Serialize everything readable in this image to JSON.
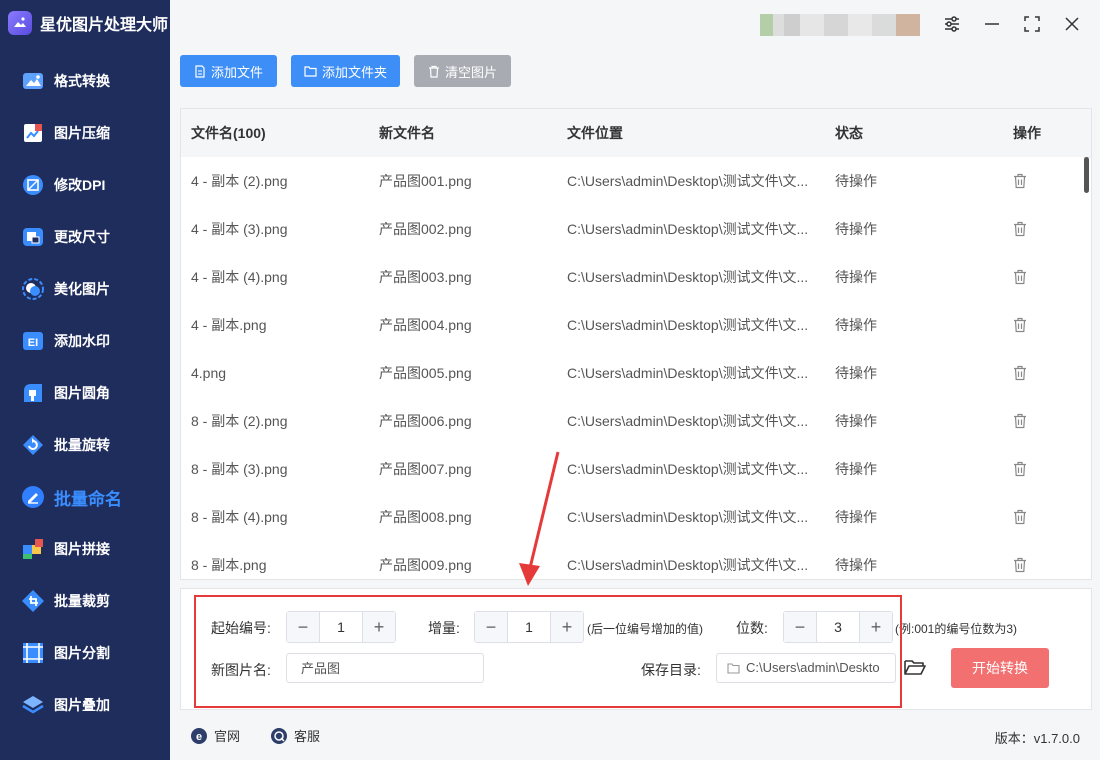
{
  "app": {
    "title": "星优图片处理大师"
  },
  "sidebar": {
    "items": [
      {
        "label": "格式转换",
        "icon": "format-convert-icon"
      },
      {
        "label": "图片压缩",
        "icon": "compress-icon"
      },
      {
        "label": "修改DPI",
        "icon": "dpi-icon"
      },
      {
        "label": "更改尺寸",
        "icon": "resize-icon"
      },
      {
        "label": "美化图片",
        "icon": "beautify-icon"
      },
      {
        "label": "添加水印",
        "icon": "watermark-icon"
      },
      {
        "label": "图片圆角",
        "icon": "rounded-corner-icon"
      },
      {
        "label": "批量旋转",
        "icon": "rotate-icon"
      },
      {
        "label": "批量命名",
        "icon": "rename-icon",
        "active": true
      },
      {
        "label": "图片拼接",
        "icon": "splice-icon"
      },
      {
        "label": "批量裁剪",
        "icon": "crop-icon"
      },
      {
        "label": "图片分割",
        "icon": "split-icon"
      },
      {
        "label": "图片叠加",
        "icon": "overlay-icon"
      }
    ]
  },
  "toolbar": {
    "add_file": "添加文件",
    "add_folder": "添加文件夹",
    "clear": "清空图片"
  },
  "table": {
    "headers": [
      "文件名(100)",
      "新文件名",
      "文件位置",
      "状态",
      "操作"
    ],
    "rows": [
      [
        "4 - 副本 (2).png",
        "产品图001.png",
        "C:\\Users\\admin\\Desktop\\测试文件\\文...",
        "待操作"
      ],
      [
        "4 - 副本 (3).png",
        "产品图002.png",
        "C:\\Users\\admin\\Desktop\\测试文件\\文...",
        "待操作"
      ],
      [
        "4 - 副本 (4).png",
        "产品图003.png",
        "C:\\Users\\admin\\Desktop\\测试文件\\文...",
        "待操作"
      ],
      [
        "4 - 副本.png",
        "产品图004.png",
        "C:\\Users\\admin\\Desktop\\测试文件\\文...",
        "待操作"
      ],
      [
        "4.png",
        "产品图005.png",
        "C:\\Users\\admin\\Desktop\\测试文件\\文...",
        "待操作"
      ],
      [
        "8 - 副本 (2).png",
        "产品图006.png",
        "C:\\Users\\admin\\Desktop\\测试文件\\文...",
        "待操作"
      ],
      [
        "8 - 副本 (3).png",
        "产品图007.png",
        "C:\\Users\\admin\\Desktop\\测试文件\\文...",
        "待操作"
      ],
      [
        "8 - 副本 (4).png",
        "产品图008.png",
        "C:\\Users\\admin\\Desktop\\测试文件\\文...",
        "待操作"
      ],
      [
        "8 - 副本.png",
        "产品图009.png",
        "C:\\Users\\admin\\Desktop\\测试文件\\文...",
        "待操作"
      ]
    ]
  },
  "settings": {
    "start_label": "起始编号:",
    "start_value": "1",
    "increment_label": "增量:",
    "increment_value": "1",
    "increment_hint": "(后一位编号增加的值)",
    "digits_label": "位数:",
    "digits_value": "3",
    "digits_hint": "(例:001的编号位数为3)",
    "newname_label": "新图片名:",
    "newname_value": "产品图",
    "save_label": "保存目录:",
    "save_value": "C:\\Users\\admin\\Deskto",
    "start_button": "开始转换"
  },
  "footer": {
    "website": "官网",
    "support": "客服",
    "version": "版本：v1.7.0.0"
  },
  "colors": {
    "sidebar_bg": "#1f2d5c",
    "active": "#3a8dff",
    "primary": "#3d8ef6",
    "danger": "#f37070",
    "highlight": "#e63a3a"
  }
}
